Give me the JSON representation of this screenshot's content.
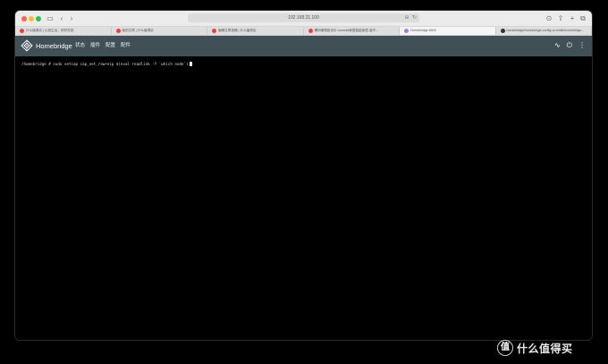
{
  "browser": {
    "url": "192.168.31.100",
    "reader_label": "⊞",
    "tabs": [
      {
        "title": "什么值得买 | 认真生活，好好花钱",
        "favicon_color": "#e8413c",
        "active": false
      },
      {
        "title": "我的文章 | 什么值得买",
        "favicon_color": "#e8413c",
        "active": false
      },
      {
        "title": "编辑文章投稿 | 什么值得买",
        "favicon_color": "#e8413c",
        "active": false
      },
      {
        "title": "爆料晒物投评价-homekit家庭智能家居 值不...",
        "favicon_color": "#e8413c",
        "active": false
      },
      {
        "title": "Homebridge 8003",
        "favicon_color": "#9b86d8",
        "active": true
      },
      {
        "title": "homebridge/homebridge-config-ui-x/wiki/homebridge...",
        "favicon_color": "#333333",
        "active": false
      }
    ]
  },
  "app": {
    "brand": "Homebridge",
    "nav": [
      "状态",
      "插件",
      "配置",
      "配件"
    ],
    "colors": {
      "header": "#414f57",
      "terminal_bg": "#000000",
      "terminal_fg": "#d8d8d8"
    }
  },
  "terminal": {
    "line": "/homebridge # sudo setcap cap_net_raw+eip $(eval readlink -f `which node`)"
  },
  "watermark": {
    "badge": "值",
    "text": "什么值得买"
  }
}
